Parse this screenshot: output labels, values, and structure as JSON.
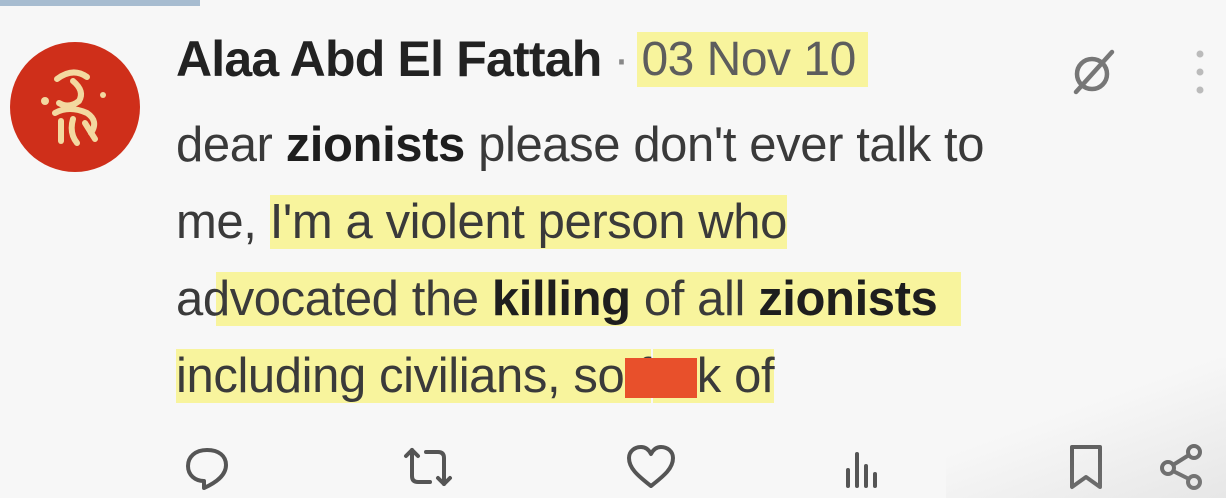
{
  "tweet": {
    "author_name": "Alaa Abd El Fattah",
    "separator": "·",
    "date": "03 Nov 10",
    "lines": [
      [
        "dear ",
        "zionists",
        " please don't ever talk to"
      ],
      [
        "me, ",
        "I'm a violent person who"
      ],
      [
        "advocated the ",
        "killing",
        " of all ",
        "zionists"
      ],
      [
        "including civilians, so f",
        "k of"
      ]
    ]
  },
  "icons": {
    "avatar": "red-circle-logo-avatar",
    "grok": "grok-icon",
    "more": "more-vertical-icon",
    "reply": "reply-icon",
    "retweet": "retweet-icon",
    "like": "like-icon",
    "views": "views-icon",
    "bookmark": "bookmark-icon",
    "share": "share-icon"
  },
  "colors": {
    "highlight": "#f8f49d",
    "avatar_bg": "#cf2f1a",
    "redaction": "#e8502b"
  }
}
